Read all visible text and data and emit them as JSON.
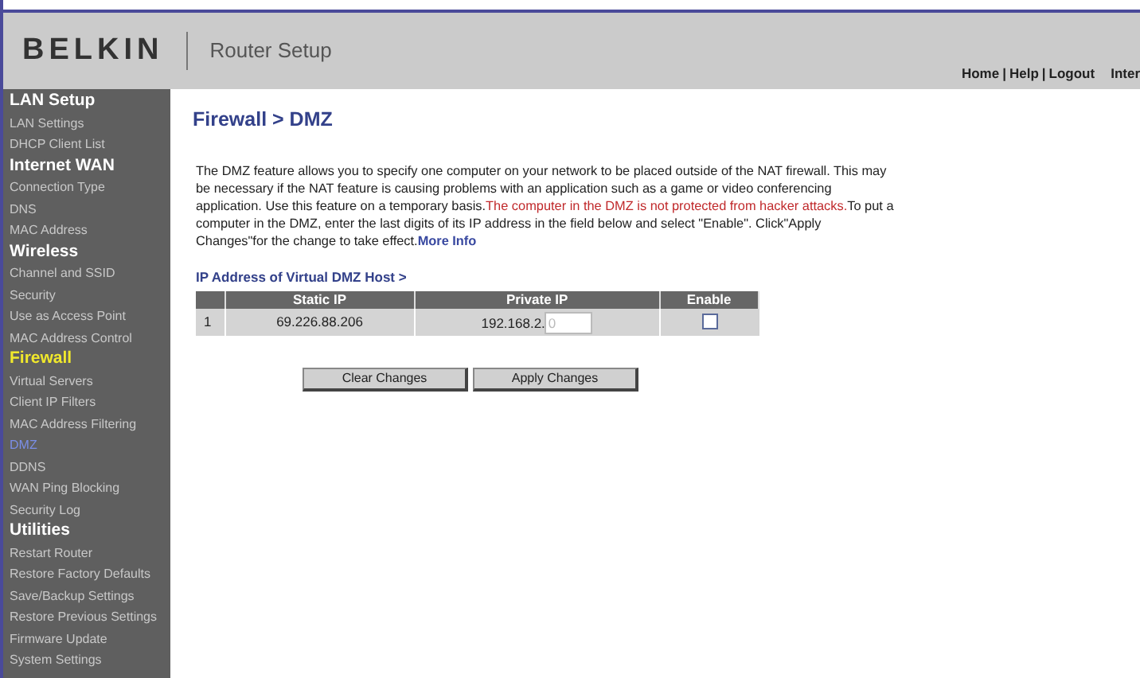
{
  "header": {
    "brand": "BELKIN",
    "title": "Router Setup",
    "nav": [
      "Home",
      "Help",
      "Logout"
    ],
    "nav_separator": "|",
    "nav_extra": "Inter"
  },
  "sidebar": {
    "items": [
      {
        "label": "LAN Setup",
        "kind": "heading",
        "selected": false
      },
      {
        "label": "LAN Settings",
        "kind": "link",
        "selected": false
      },
      {
        "label": "DHCP Client List",
        "kind": "link",
        "selected": false
      },
      {
        "label": "Internet WAN",
        "kind": "heading",
        "selected": false
      },
      {
        "label": "Connection Type",
        "kind": "link",
        "selected": false
      },
      {
        "label": "DNS",
        "kind": "link",
        "selected": false
      },
      {
        "label": "MAC Address",
        "kind": "link",
        "selected": false
      },
      {
        "label": "Wireless",
        "kind": "heading",
        "selected": false
      },
      {
        "label": "Channel and SSID",
        "kind": "link",
        "selected": false
      },
      {
        "label": "Security",
        "kind": "link",
        "selected": false
      },
      {
        "label": "Use as Access Point",
        "kind": "link",
        "selected": false
      },
      {
        "label": "MAC Address Control",
        "kind": "link",
        "selected": false
      },
      {
        "label": "Firewall",
        "kind": "heading",
        "selected": true
      },
      {
        "label": "Virtual Servers",
        "kind": "link",
        "selected": false
      },
      {
        "label": "Client IP Filters",
        "kind": "link",
        "selected": false
      },
      {
        "label": "MAC Address Filtering",
        "kind": "link",
        "selected": false
      },
      {
        "label": "DMZ",
        "kind": "link",
        "selected": true
      },
      {
        "label": "DDNS",
        "kind": "link",
        "selected": false
      },
      {
        "label": "WAN Ping Blocking",
        "kind": "link",
        "selected": false
      },
      {
        "label": "Security Log",
        "kind": "link",
        "selected": false
      },
      {
        "label": "Utilities",
        "kind": "heading",
        "selected": false
      },
      {
        "label": "Restart Router",
        "kind": "link",
        "selected": false
      },
      {
        "label": "Restore Factory Defaults",
        "kind": "link",
        "selected": false
      },
      {
        "label": "Save/Backup Settings",
        "kind": "link",
        "selected": false
      },
      {
        "label": "Restore Previous Settings",
        "kind": "link",
        "selected": false
      },
      {
        "label": "Firmware Update",
        "kind": "link",
        "selected": false
      },
      {
        "label": "System Settings",
        "kind": "link",
        "selected": false
      }
    ]
  },
  "page_title": "Firewall > DMZ",
  "description": [
    {
      "kind": "plain",
      "text": "The DMZ feature allows you to specify one computer on your network to be placed outside of the NAT firewall. This may be necessary if the NAT feature is causing problems with an application such as a game or video conferencing application. Use this feature on a temporary basis."
    },
    {
      "kind": "warning",
      "text": "The computer in the DMZ is not protected from hacker attacks."
    },
    {
      "kind": "plain",
      "text": "To put a computer in the DMZ, enter the last digits of its IP address in the field below and select \"Enable\". Click\"Apply Changes\"for the change to take effect."
    },
    {
      "kind": "link",
      "text": "More Info"
    }
  ],
  "table": {
    "title": "IP Address of Virtual DMZ Host >",
    "columns": [
      "Static IP",
      "Private IP",
      "Enable"
    ],
    "rows": [
      {
        "index": "1",
        "static_ip": "69.226.88.206",
        "private_ip_prefix": "192.168.2.",
        "private_ip_placeholder": "0",
        "enabled": false
      }
    ]
  },
  "buttons": [
    "Clear Changes",
    "Apply Changes"
  ]
}
